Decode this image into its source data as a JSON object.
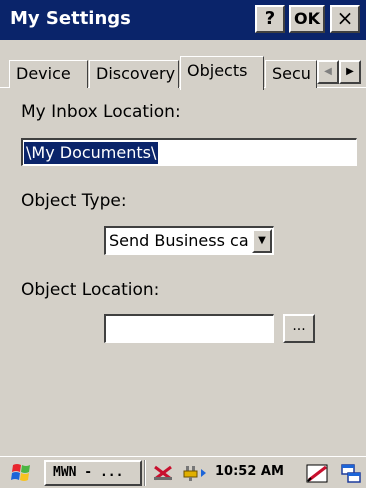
{
  "window": {
    "title": "My Settings",
    "help_label": "?",
    "ok_label": "OK",
    "close_label": "×"
  },
  "tabs": [
    {
      "label": "Device"
    },
    {
      "label": "Discovery"
    },
    {
      "label": "Objects",
      "selected": true
    },
    {
      "label": "Secu"
    }
  ],
  "tab_scroll": {
    "left": "◀",
    "right": "▶"
  },
  "form": {
    "inbox_label": "My Inbox Location:",
    "inbox_value": "\\My Documents\\",
    "object_type_label": "Object Type:",
    "object_type_value": "Send Business ca",
    "object_location_label": "Object Location:",
    "object_location_value": "",
    "browse_label": "..."
  },
  "taskbar": {
    "task_label": "MWN - ...",
    "clock": "10:52 AM"
  },
  "icons": {
    "start": "windows-flag-icon",
    "tray": [
      "network-icon",
      "power-plug-icon",
      "pen-input-icon",
      "windows-list-icon"
    ]
  },
  "colors": {
    "titlebar": "#0a246a",
    "face": "#d4d0c8",
    "selection": "#0a246a"
  }
}
